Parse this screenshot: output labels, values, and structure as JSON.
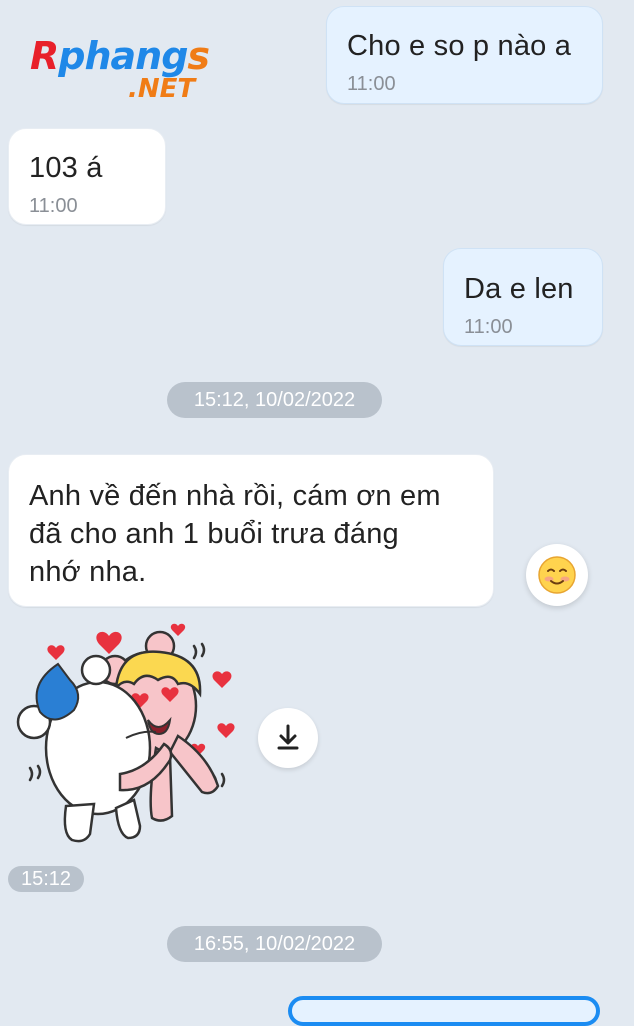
{
  "logo": {
    "main": "Rphangs",
    "suffix": ".NET",
    "color_r": "#e8202a",
    "color_phangs": "#1f88e8",
    "color_net": "#f07c16"
  },
  "messages": [
    {
      "direction": "out",
      "text": "Cho e so p nào a",
      "time": "11:00"
    },
    {
      "direction": "in",
      "text": "103 á",
      "time": "11:00"
    },
    {
      "direction": "out",
      "text": "Da e len",
      "time": "11:00"
    }
  ],
  "date_separators": [
    "15:12, 10/02/2022",
    "16:55, 10/02/2022"
  ],
  "long_message": {
    "lines": [
      "Anh về đến nhà rồi, cám ơn em",
      "đã cho anh 1 buổi trưa đáng",
      "nhớ nha."
    ]
  },
  "reaction": {
    "icon": "smiling-face-icon"
  },
  "sticker": {
    "name": "hugging-bear-sticker",
    "time": "15:12"
  },
  "download": {
    "icon": "download-icon"
  },
  "colors": {
    "background": "#e2e9f1",
    "outgoing_bubble": "#e5f2ff",
    "incoming_bubble": "#ffffff",
    "pill": "#b9c2cc",
    "accent": "#1b8cf2"
  }
}
